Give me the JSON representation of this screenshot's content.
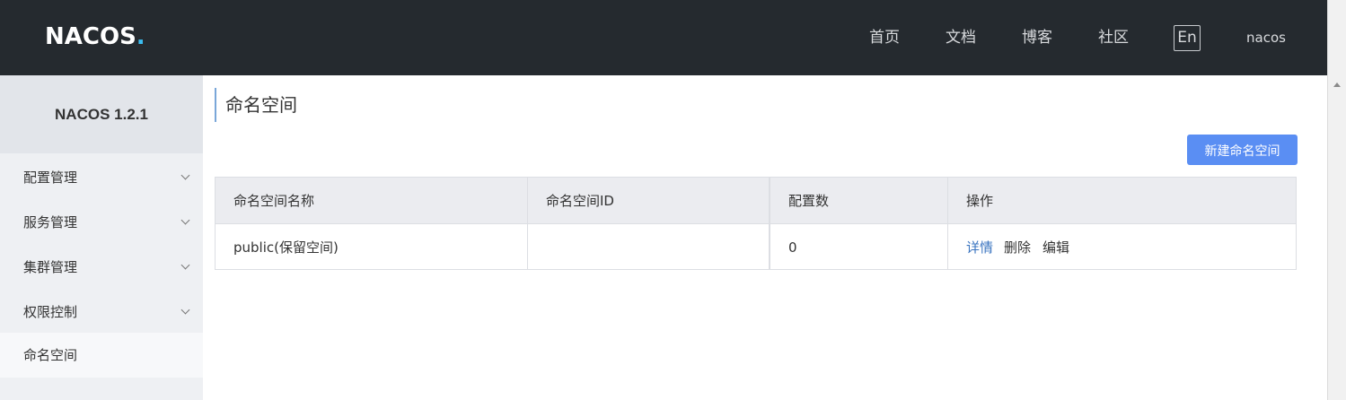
{
  "header": {
    "logo_text": "NACOS",
    "logo_dot": ".",
    "nav": {
      "home": "首页",
      "docs": "文档",
      "blog": "博客",
      "community": "社区"
    },
    "language_button": "En",
    "username": "nacos"
  },
  "sidebar": {
    "version": "NACOS 1.2.1",
    "items": [
      {
        "label": "配置管理"
      },
      {
        "label": "服务管理"
      },
      {
        "label": "集群管理"
      },
      {
        "label": "权限控制"
      },
      {
        "label": "命名空间"
      }
    ]
  },
  "main": {
    "title": "命名空间",
    "create_button": "新建命名空间",
    "table": {
      "columns": [
        "命名空间名称",
        "命名空间ID",
        "配置数",
        "操作"
      ],
      "rows": [
        {
          "name": "public(保留空间)",
          "id": "",
          "config_count": "0",
          "actions": {
            "detail": "详情",
            "delete": "删除",
            "edit": "编辑"
          }
        }
      ]
    }
  },
  "colors": {
    "header_bg": "#252a2f",
    "sidebar_bg": "#eef0f3",
    "primary": "#5a8ef3",
    "link": "#3a74c0"
  }
}
